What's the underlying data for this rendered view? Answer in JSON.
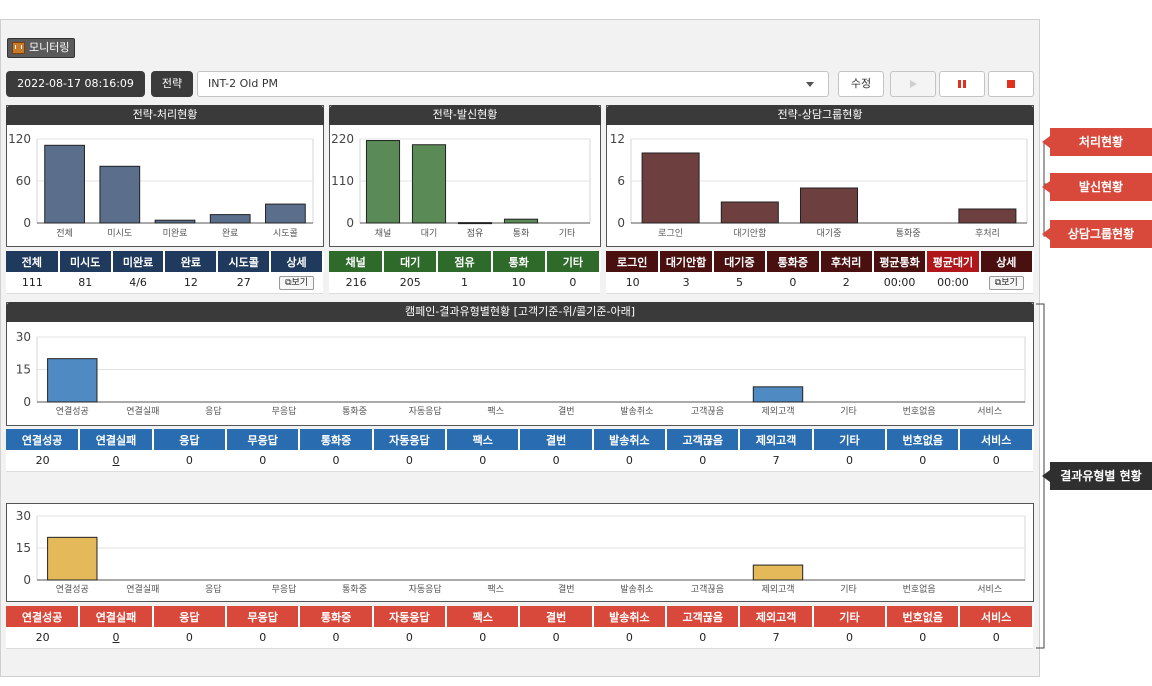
{
  "header": {
    "title": "모니터링",
    "datetime": "2022-08-17 08:16:09",
    "strategy_label": "전략",
    "strategy_value": "INT-2 Old PM",
    "edit_label": "수정"
  },
  "panels": {
    "process": {
      "title": "전략-처리현황",
      "chart_data": {
        "type": "bar",
        "categories": [
          "전체",
          "미시도",
          "미완료",
          "완료",
          "시도콜"
        ],
        "values": [
          111,
          81,
          4,
          12,
          27
        ],
        "ylim": [
          0,
          120
        ],
        "yticks": [
          0,
          60,
          120
        ],
        "color": "#5b6f8c"
      },
      "headers": [
        "전체",
        "미시도",
        "미완료",
        "완료",
        "시도콜",
        "상세"
      ],
      "values": [
        "111",
        "81",
        "4/6",
        "12",
        "27"
      ],
      "view_label": "보기",
      "header_color": "#1f3a5c"
    },
    "outbound": {
      "title": "전략-발신현황",
      "chart_data": {
        "type": "bar",
        "categories": [
          "채널",
          "대기",
          "점유",
          "통화",
          "기타"
        ],
        "values": [
          216,
          205,
          1,
          10,
          0
        ],
        "ylim": [
          0,
          220
        ],
        "yticks": [
          0,
          110,
          220
        ],
        "color": "#5a8a56"
      },
      "headers": [
        "채널",
        "대기",
        "점유",
        "통화",
        "기타"
      ],
      "values": [
        "216",
        "205",
        "1",
        "10",
        "0"
      ],
      "header_color": "#2e6b2a"
    },
    "group": {
      "title": "전략-상담그룹현황",
      "chart_data": {
        "type": "bar",
        "categories": [
          "로그인",
          "대기안함",
          "대기중",
          "통화중",
          "후처리"
        ],
        "values": [
          10,
          3,
          5,
          0,
          2
        ],
        "ylim": [
          0,
          12
        ],
        "yticks": [
          0,
          6,
          12
        ],
        "color": "#6e3f3f"
      },
      "headers": [
        "로그인",
        "대기안함",
        "대기중",
        "통화중",
        "후처리",
        "평균통화",
        "평균대기",
        "상세"
      ],
      "values": [
        "10",
        "3",
        "5",
        "0",
        "2",
        "00:00",
        "00:00"
      ],
      "view_label": "보기",
      "header_color": "#4a1010",
      "highlight_color": "#b0171b"
    },
    "campaign": {
      "title": "캠페인-결과유형별현황 [고객기준-위/콜기준-아래]",
      "categories": [
        "연결성공",
        "연결실패",
        "응답",
        "무응답",
        "통화중",
        "자동응답",
        "팩스",
        "결번",
        "발송취소",
        "고객끊음",
        "제외고객",
        "기타",
        "번호없음",
        "서비스"
      ],
      "customer": {
        "chart_data": {
          "type": "bar",
          "categories": [
            "연결성공",
            "연결실패",
            "응답",
            "무응답",
            "통화중",
            "자동응답",
            "팩스",
            "결번",
            "발송취소",
            "고객끊음",
            "제외고객",
            "기타",
            "번호없음",
            "서비스"
          ],
          "values": [
            20,
            0,
            0,
            0,
            0,
            0,
            0,
            0,
            0,
            0,
            7,
            0,
            0,
            0
          ],
          "ylim": [
            0,
            30
          ],
          "yticks": [
            0,
            15,
            30
          ],
          "color": "#4f8ac2"
        },
        "values": [
          "20",
          "0",
          "0",
          "0",
          "0",
          "0",
          "0",
          "0",
          "0",
          "0",
          "7",
          "0",
          "0",
          "0"
        ],
        "header_color": "#2a6cb0"
      },
      "call": {
        "chart_data": {
          "type": "bar",
          "categories": [
            "연결성공",
            "연결실패",
            "응답",
            "무응답",
            "통화중",
            "자동응답",
            "팩스",
            "결번",
            "발송취소",
            "고객끊음",
            "제외고객",
            "기타",
            "번호없음",
            "서비스"
          ],
          "values": [
            20,
            0,
            0,
            0,
            0,
            0,
            0,
            0,
            0,
            0,
            7,
            0,
            0,
            0
          ],
          "ylim": [
            0,
            30
          ],
          "yticks": [
            0,
            15,
            30
          ],
          "color": "#e3b95a"
        },
        "values": [
          "20",
          "0",
          "0",
          "0",
          "0",
          "0",
          "0",
          "0",
          "0",
          "0",
          "7",
          "0",
          "0",
          "0"
        ],
        "header_color": "#d8483b"
      }
    }
  },
  "callouts": {
    "process": "처리현황",
    "outbound": "발신현황",
    "group": "상담그룹현황",
    "campaign": "결과유형별 현황"
  },
  "colors": {
    "dark_header": "#3a3a3a",
    "callout_red": "#d8483b",
    "callout_dark": "#2f2f2f"
  }
}
